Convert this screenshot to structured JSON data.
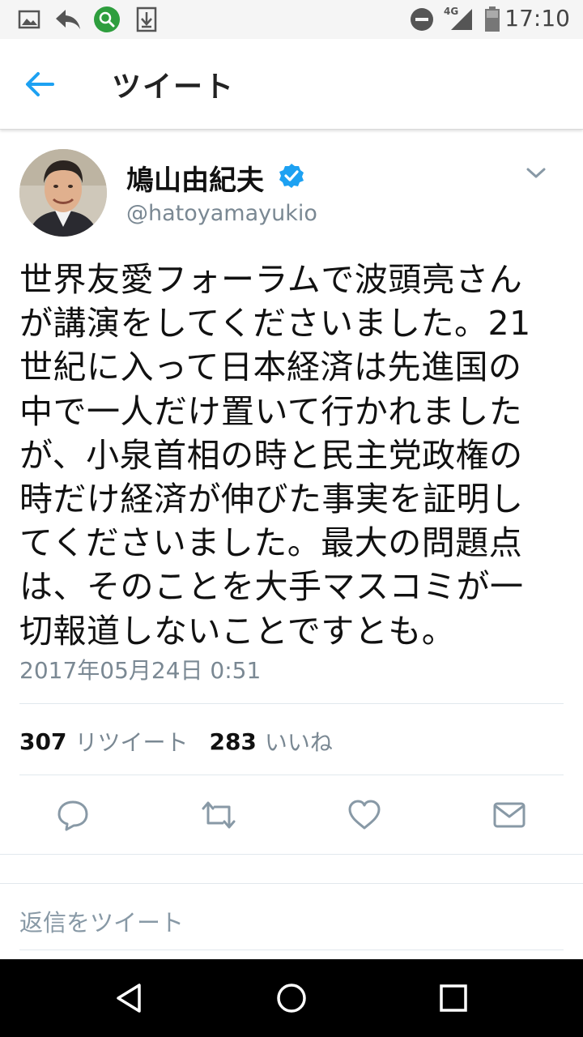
{
  "status_bar": {
    "time": "17:10",
    "network": "4G",
    "icons": [
      "gallery-icon",
      "reply-arrow-icon",
      "search-badge-icon",
      "download-icon",
      "do-not-disturb-icon",
      "signal-icon",
      "battery-icon"
    ]
  },
  "app_bar": {
    "title": "ツイート",
    "back_icon": "back-arrow-icon"
  },
  "tweet": {
    "author_name": "鳩山由紀夫",
    "handle": "@hatoyamayukio",
    "verified": true,
    "text_lines": [
      "世界友愛フォーラムで波頭亮さん",
      "が講演をしてくださいました。21",
      "世紀に入って日本経済は先進国の",
      "中で一人だけ置いて行かれました",
      "が、小泉首相の時と民主党政権の",
      "時だけ経済が伸びた事実を証明し",
      "てくださいました。最大の問題点",
      "は、そのことを大手マスコミが一",
      "切報道しないことですとも。"
    ],
    "timestamp": "2017年05月24日 0:51",
    "retweet_count": "307",
    "retweet_label": "リツイート",
    "like_count": "283",
    "like_label": "いいね"
  },
  "actions": [
    "reply-icon",
    "retweet-icon",
    "like-icon",
    "message-icon"
  ],
  "reply_placeholder": "返信をツイート",
  "nav_bar": [
    "nav-back-icon",
    "nav-home-icon",
    "nav-recents-icon"
  ],
  "colors": {
    "accent": "#1da1f2",
    "secondary_text": "#7a8893",
    "primary_text": "#111111",
    "status_bar_bg": "#f5f5f5",
    "badge_green": "#2e9e3e"
  }
}
